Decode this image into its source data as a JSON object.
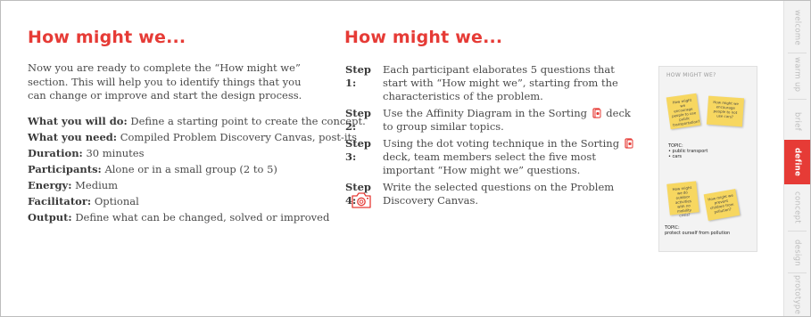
{
  "left": {
    "title": "How might we...",
    "intro": "Now you are ready to complete the “How might we” section. This will help you to identify things that you can change or improve and start the design process.",
    "details": [
      {
        "label": "What you will do:",
        "value": "Define a starting point to create the concept."
      },
      {
        "label": "What you need:",
        "value": "Compiled Problem Discovery Canvas, post-its"
      },
      {
        "label": "Duration:",
        "value": "30 minutes"
      },
      {
        "label": "Participants:",
        "value": "Alone or in a small group (2 to 5)"
      },
      {
        "label": "Energy:",
        "value": "Medium"
      },
      {
        "label": "Facilitator:",
        "value": "Optional"
      },
      {
        "label": "Output:",
        "value": "Define what can be changed, solved or improved"
      }
    ]
  },
  "right": {
    "title": "How might we...",
    "steps": [
      {
        "label": "Step 1:",
        "text": "Each participant elaborates 5 questions that start with “How might we”, starting from the characteristics of the problem."
      },
      {
        "label": "Step 2:",
        "text_before": "Use the Affinity Diagram in the Sorting",
        "text_after": "deck to group similar topics."
      },
      {
        "label": "Step 3:",
        "text_before": "Using the dot voting technique in the Sorting",
        "text_after": "deck, team members select the five most important “How might we” questions."
      },
      {
        "label": "Step 4:",
        "text": "Write the selected questions on the Problem Discovery Canvas."
      }
    ]
  },
  "thumbnail": {
    "header": "HOW MIGHT WE?",
    "notes": [
      "How might we encourage people to use public transportation?",
      "How might we encourage people to not use cars?",
      "How might we do outdoor activities with no mobility crisis?",
      "How might we prevent children from pollution?"
    ],
    "topic1_label": "TOPIC:",
    "topic1_items": [
      "• public transport",
      "• cars"
    ],
    "topic2_label": "TOPIC:",
    "topic2_text": "protect ourself from pollution"
  },
  "sidebar": {
    "tabs": [
      "welcome",
      "warm up",
      "brief",
      "define",
      "concept",
      "design",
      "prototype"
    ],
    "active": "define"
  },
  "colors": {
    "accent": "#e63b36",
    "text": "#4a4a4a",
    "sidebar_bg": "#f2f2f2",
    "note": "#f7d760"
  },
  "icons": {
    "deck": "sorting-deck-icon",
    "camera": "camera-icon"
  }
}
